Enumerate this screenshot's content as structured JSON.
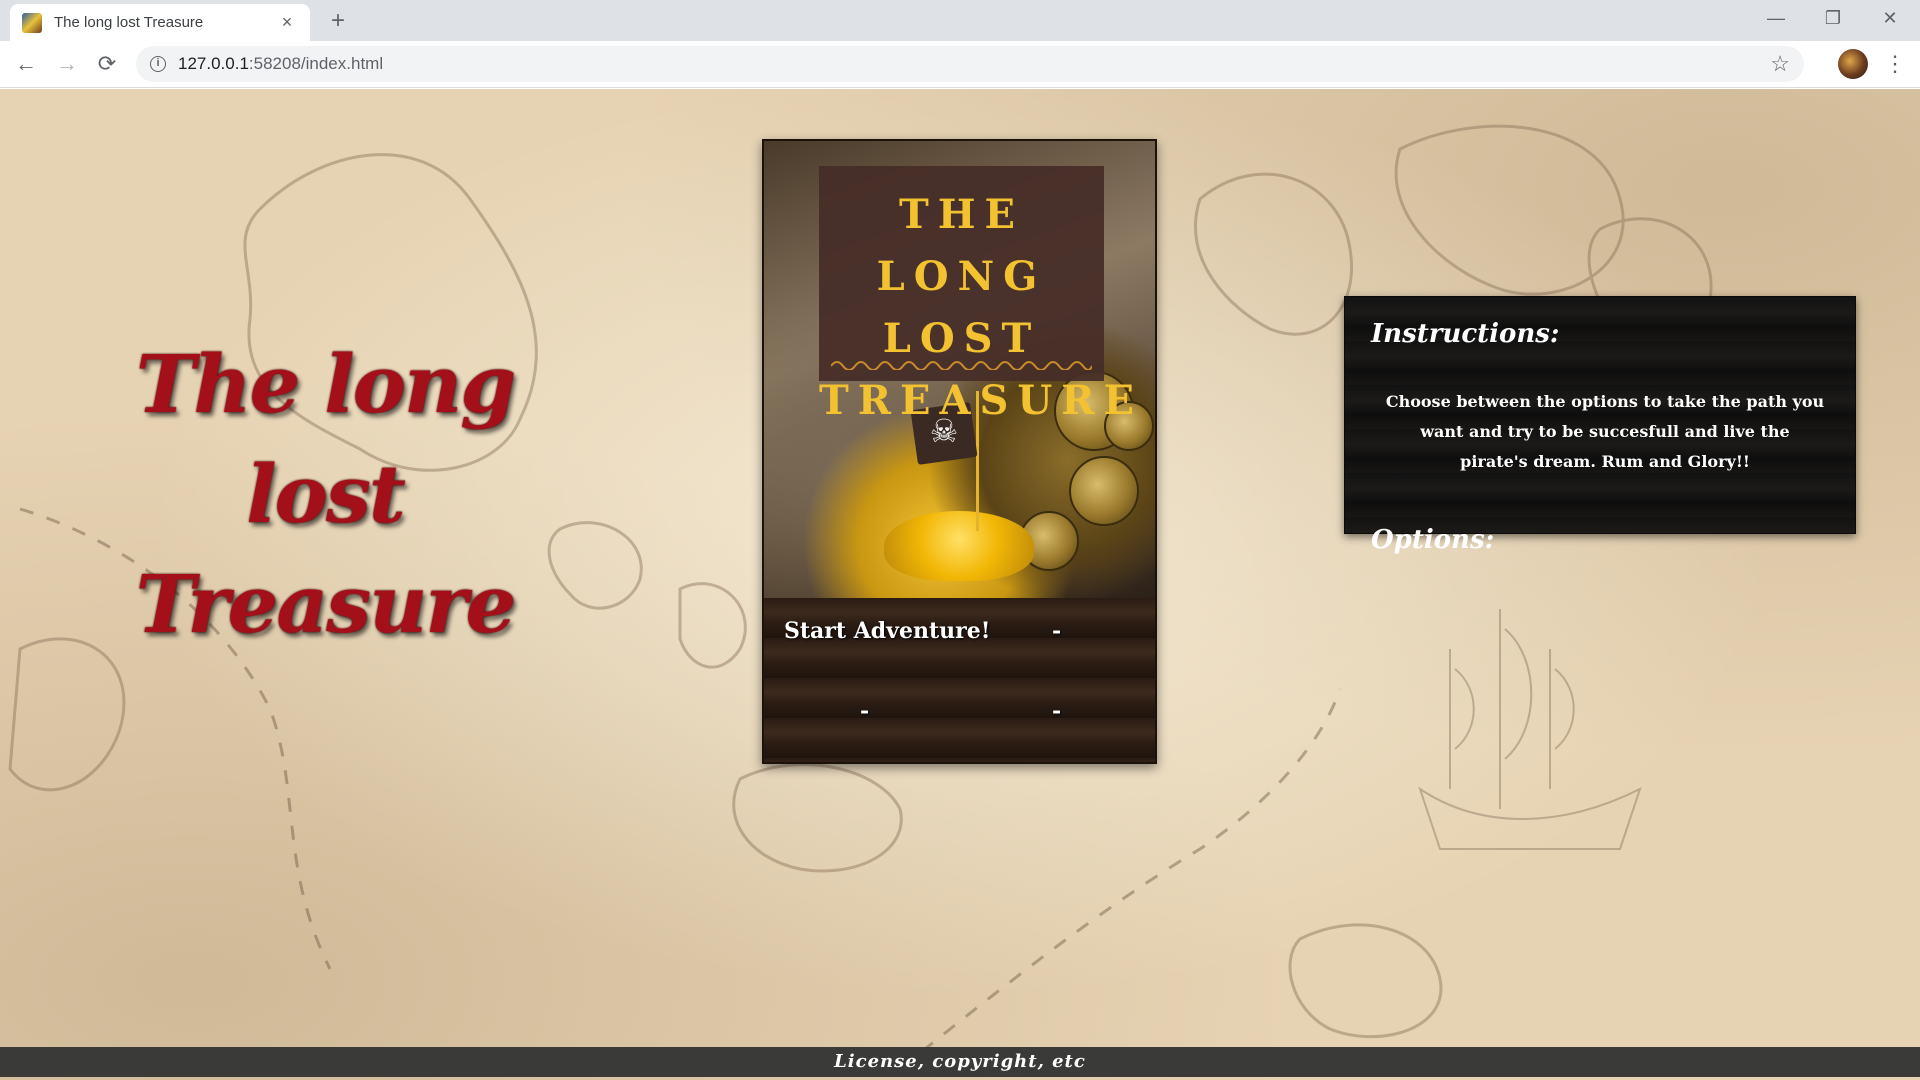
{
  "browser": {
    "tab_title": "The long lost Treasure",
    "tab_close": "×",
    "new_tab": "+",
    "url_host": "127.0.0.1",
    "url_rest": ":58208/index.html",
    "win_min": "—",
    "win_max": "❐",
    "win_close": "✕",
    "back": "←",
    "forward": "→",
    "reload": "⟳",
    "star": "☆",
    "menu": "⋮",
    "info": "i"
  },
  "page": {
    "title": "The long lost Treasure",
    "card": {
      "logo_text": "THE LONG LOST TREASURE",
      "skull": "☠",
      "buttons": {
        "start": "Start Adventure!",
        "option2": "-",
        "option3": "-",
        "option4": "-"
      }
    },
    "panel": {
      "instructions_heading": "Instructions:",
      "instructions_text": "Choose between the options to take the path you want and try to be succesfull and live the pirate's dream. Rum and Glory!!",
      "options_heading": "Options:"
    },
    "footer": "License, copyright, etc"
  },
  "colors": {
    "title_red": "#a3101a",
    "logo_gold": "#f2c230",
    "parchment": "#e6d3b3"
  }
}
